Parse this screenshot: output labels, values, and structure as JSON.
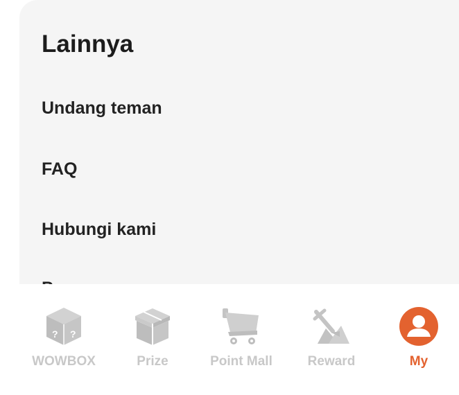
{
  "section": {
    "title": "Lainnya",
    "items": [
      {
        "label": "Undang teman"
      },
      {
        "label": "FAQ"
      },
      {
        "label": "Hubungi kami"
      },
      {
        "label": "P"
      }
    ]
  },
  "bottom_nav": {
    "items": [
      {
        "label": "WOWBOX",
        "icon": "mystery-box-icon",
        "active": false
      },
      {
        "label": "Prize",
        "icon": "gift-box-icon",
        "active": false
      },
      {
        "label": "Point Mall",
        "icon": "shopping-cart-icon",
        "active": false
      },
      {
        "label": "Reward",
        "icon": "reward-icon",
        "active": false
      },
      {
        "label": "My",
        "icon": "user-profile-icon",
        "active": true
      }
    ],
    "colors": {
      "inactive": "#c8c8c8",
      "active": "#e3622f"
    }
  }
}
